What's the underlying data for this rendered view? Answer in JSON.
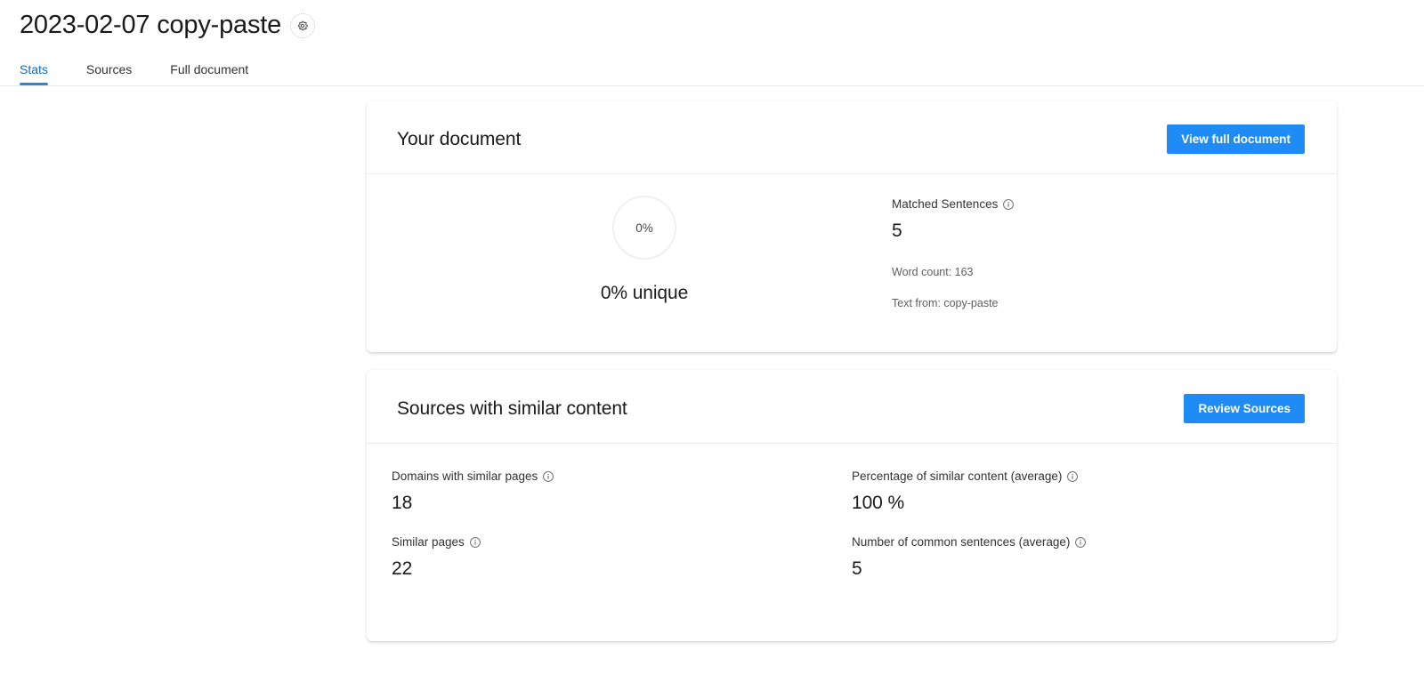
{
  "header": {
    "title": "2023-02-07 copy-paste",
    "settings_icon": "gear-icon"
  },
  "tabs": [
    {
      "label": "Stats",
      "active": true
    },
    {
      "label": "Sources",
      "active": false
    },
    {
      "label": "Full document",
      "active": false
    }
  ],
  "colors": {
    "accent_blue": "#1f8bf5",
    "tab_active": "#0f6cbd",
    "tab_underline": "#2b88d8",
    "card_bg": "#ffffff",
    "divider": "#edebe9",
    "donut_ring": "#f0f0f0",
    "page_bg": "#ffffff"
  },
  "document_card": {
    "title": "Your document",
    "action_label": "View full document",
    "gauge": {
      "inner_label": "0%",
      "caption": "0% unique",
      "percent": 0
    },
    "matched_sentences": {
      "label": "Matched Sentences",
      "info_icon": "info-icon",
      "value": "5"
    },
    "word_count": "Word count: 163",
    "text_from": "Text from: copy-paste"
  },
  "sources_card": {
    "title": "Sources with similar content",
    "action_label": "Review Sources",
    "stats": [
      {
        "label": "Domains with similar pages",
        "value": "18",
        "info_icon": "info-icon"
      },
      {
        "label": "Percentage of similar content (average)",
        "value": "100 %",
        "info_icon": "info-icon"
      },
      {
        "label": "Similar pages",
        "value": "22",
        "info_icon": "info-icon"
      },
      {
        "label": "Number of common sentences (average)",
        "value": "5",
        "info_icon": "info-icon"
      }
    ]
  }
}
